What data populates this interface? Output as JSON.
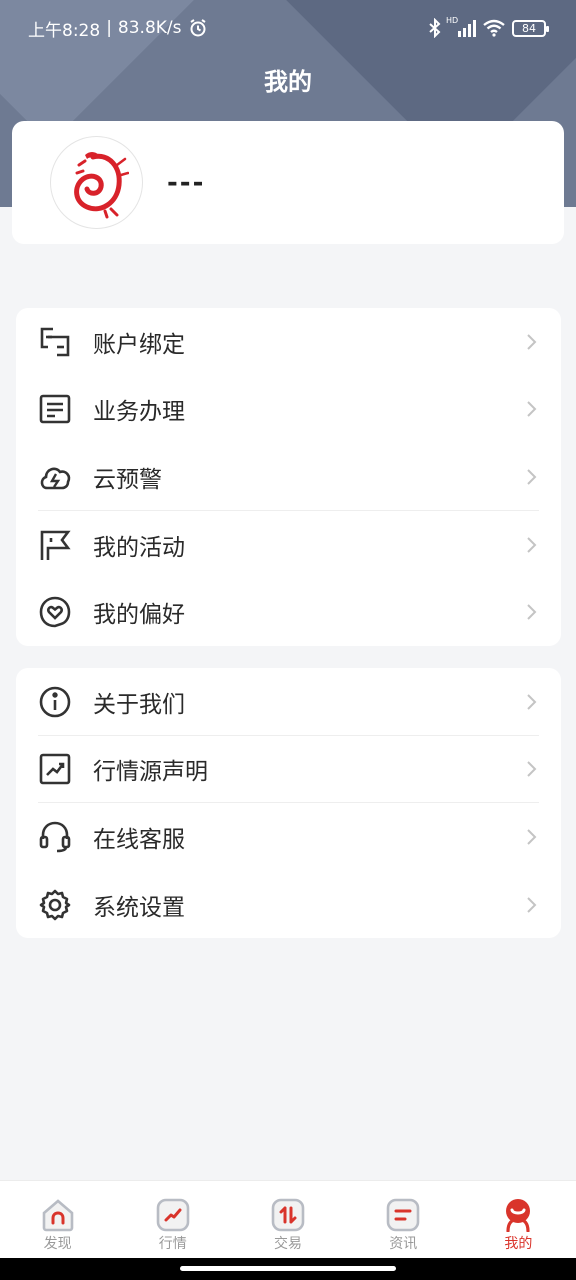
{
  "status_bar": {
    "time": "上午8:28",
    "speed": "83.8K/s",
    "network": "HD",
    "battery": "84"
  },
  "header": {
    "title": "我的"
  },
  "profile": {
    "name": "---"
  },
  "menu_group_1": [
    {
      "label": "账户绑定",
      "icon": "account-link-icon"
    },
    {
      "label": "业务办理",
      "icon": "business-form-icon"
    },
    {
      "label": "云预警",
      "icon": "cloud-alert-icon"
    },
    {
      "label": "我的活动",
      "icon": "activity-flag-icon"
    },
    {
      "label": "我的偏好",
      "icon": "preference-heart-icon"
    }
  ],
  "menu_group_2": [
    {
      "label": "关于我们",
      "icon": "info-icon"
    },
    {
      "label": "行情源声明",
      "icon": "market-source-icon"
    },
    {
      "label": "在线客服",
      "icon": "headset-icon"
    },
    {
      "label": "系统设置",
      "icon": "gear-icon"
    }
  ],
  "tabs": [
    {
      "label": "发现",
      "icon": "discover-tab-icon"
    },
    {
      "label": "行情",
      "icon": "market-tab-icon"
    },
    {
      "label": "交易",
      "icon": "trade-tab-icon"
    },
    {
      "label": "资讯",
      "icon": "news-tab-icon"
    },
    {
      "label": "我的",
      "icon": "profile-tab-icon",
      "active": true
    }
  ],
  "colors": {
    "header": "#6e7a92",
    "accent": "#d9342b",
    "background": "#f4f5f7"
  }
}
